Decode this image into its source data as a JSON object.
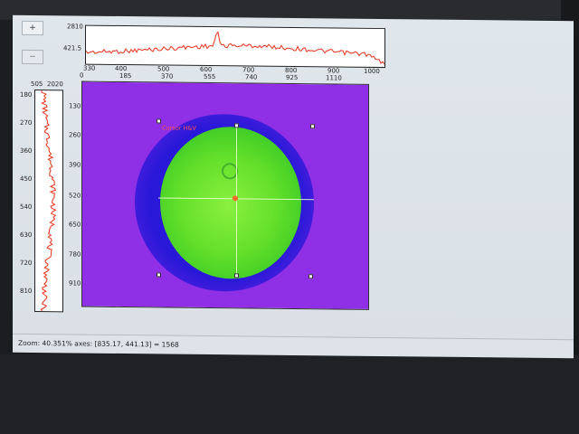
{
  "toolbar": {
    "add_label": "+",
    "minus_label": "−"
  },
  "top_profile": {
    "y_ticks": [
      "2810",
      "421.5"
    ],
    "x_ticks": [
      "330",
      "400",
      "500",
      "600",
      "700",
      "800",
      "900",
      "1000"
    ],
    "line_color": "#e8402a"
  },
  "left_profile": {
    "x_ticks": [
      "505",
      "2020"
    ],
    "y_ticks": [
      "180",
      "270",
      "360",
      "450",
      "540",
      "630",
      "720",
      "810"
    ],
    "line_color": "#e8402a"
  },
  "image_view": {
    "x_ticks": [
      "0",
      "185",
      "370",
      "555",
      "740",
      "925",
      "1110"
    ],
    "y_ticks": [
      "130",
      "260",
      "390",
      "520",
      "650",
      "780",
      "910"
    ],
    "roi_label": "Cursor H&V",
    "background_color": "#8f2fe6",
    "halo_color": "#2a18d8",
    "beam_color": "#64e02a"
  },
  "status": {
    "text": "Zoom: 40.351%   axes: [835.17, 441.13] = 1568"
  }
}
